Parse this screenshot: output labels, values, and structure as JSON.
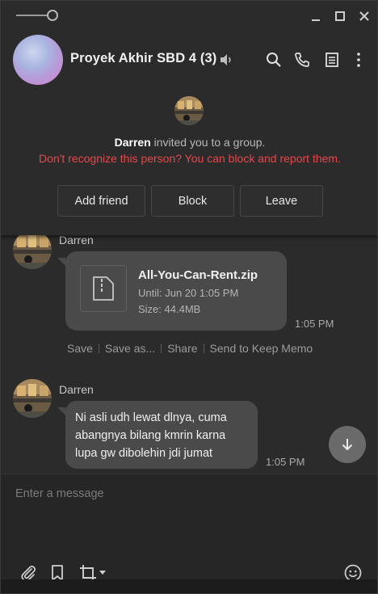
{
  "window": {
    "title": "Proyek Akhir SBD 4 (3)"
  },
  "invite": {
    "inviter": "Darren",
    "message_suffix": " invited you to a group.",
    "warning": "Don't recognize this person? You can block and report them.",
    "buttons": [
      "Add friend",
      "Block",
      "Leave"
    ]
  },
  "messages": [
    {
      "sender": "Darren",
      "type": "file",
      "file_name": "All-You-Can-Rent.zip",
      "until": "Until: Jun 20 1:05 PM",
      "size": "Size: 44.4MB",
      "time": "1:05 PM",
      "actions": [
        "Save",
        "Save as...",
        "Share",
        "Send to Keep Memo"
      ]
    },
    {
      "sender": "Darren",
      "type": "text",
      "lines": [
        "Ni asli udh lewat dlnya, cuma",
        "abangnya bilang kmrin karna",
        "lupa gw dibolehin jdi jumat"
      ],
      "time": "1:05 PM"
    }
  ],
  "composer": {
    "placeholder": "Enter a message"
  },
  "colors": {
    "warning": "#e5484d",
    "bubble": "#4a4a4a",
    "background": "#2b2b2b"
  },
  "icons": {
    "header": [
      "search-icon",
      "phone-icon",
      "notes-icon",
      "more-icon"
    ],
    "toolbar": [
      "attach-icon",
      "bookmark-icon",
      "crop-icon",
      "emoji-icon"
    ]
  }
}
